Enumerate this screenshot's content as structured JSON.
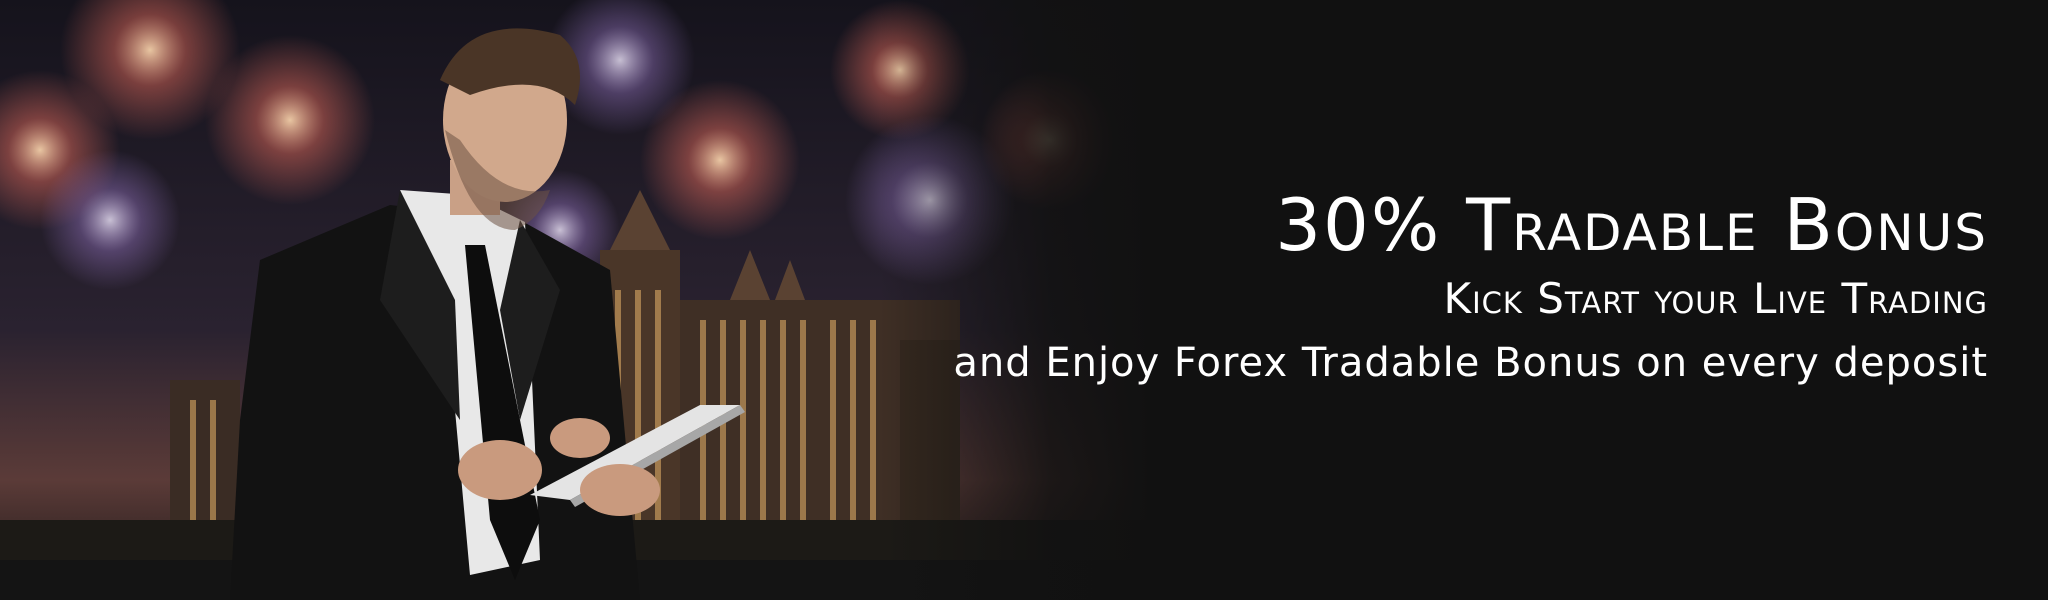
{
  "banner": {
    "headline": "30% Tradable Bonus",
    "subheadline": "Kick Start your Live Trading",
    "body": "and Enjoy Forex Tradable Bonus on every deposit"
  },
  "colors": {
    "background": "#111111",
    "text": "#ffffff",
    "sky_top": "#1b1722",
    "sky_bottom": "#5a3a3a"
  },
  "imagery": {
    "photo": "businessman-with-tablet-photo",
    "backdrop": "fireworks-over-hotel-photo"
  }
}
